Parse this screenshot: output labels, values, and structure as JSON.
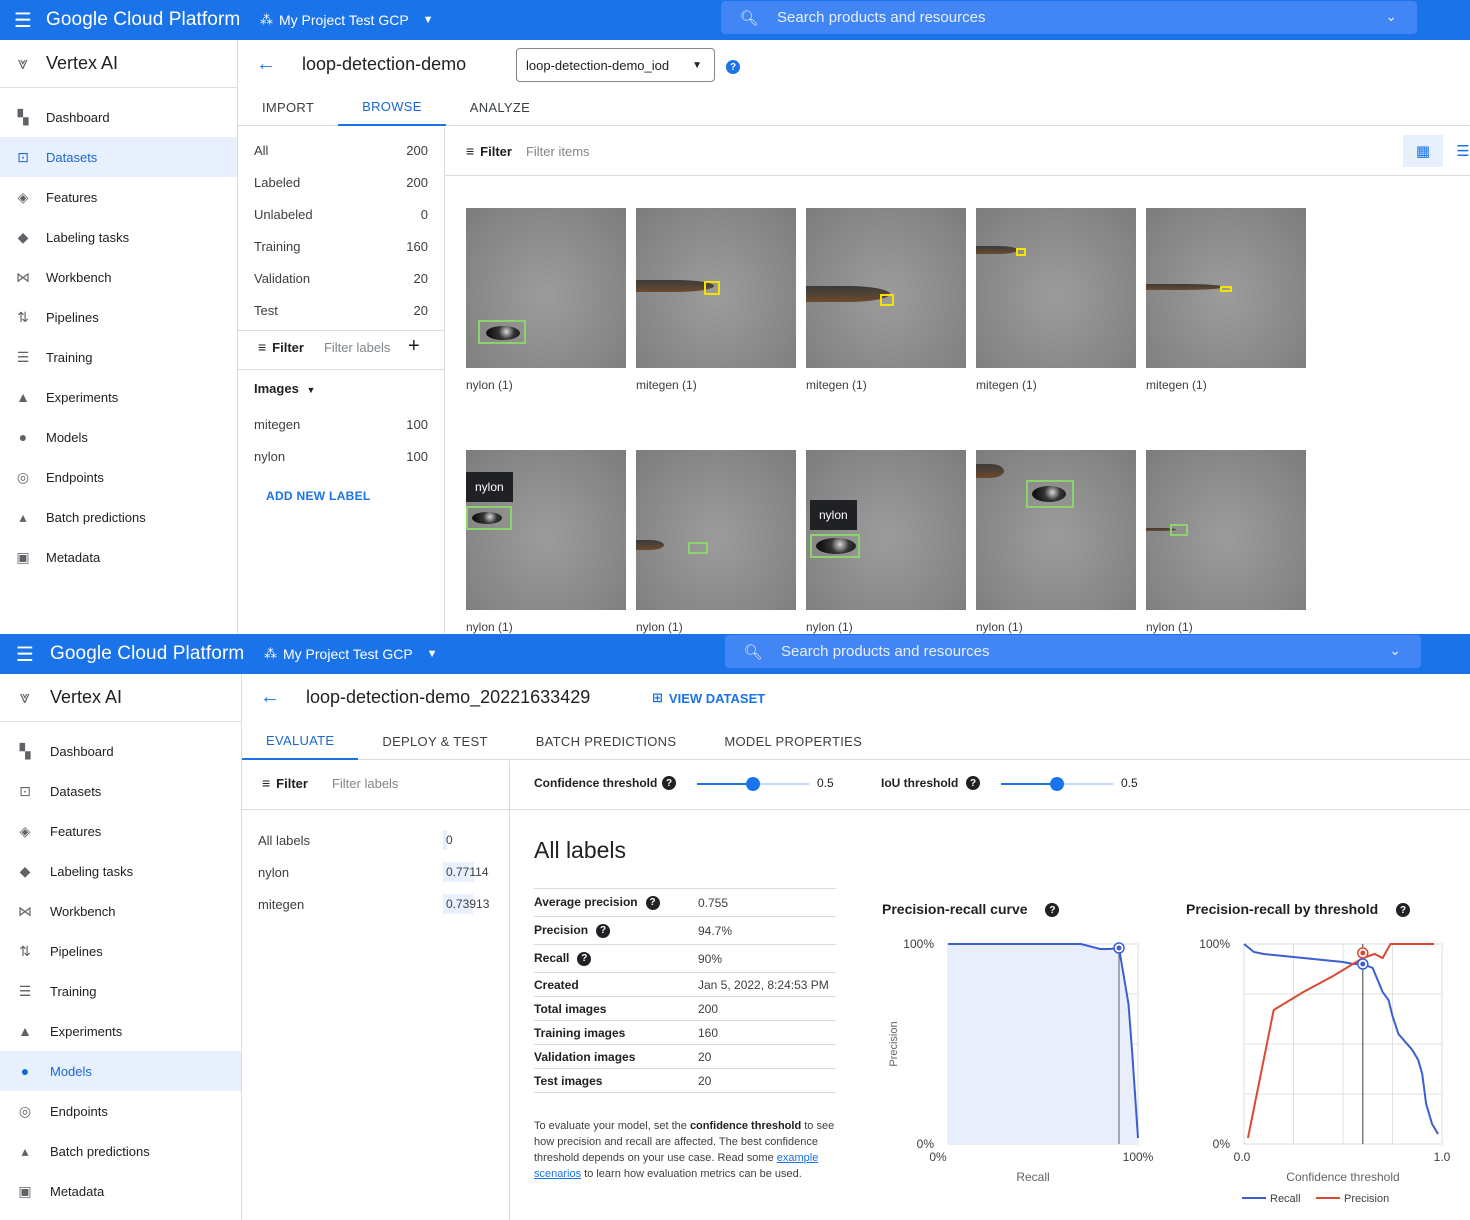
{
  "app": {
    "platform_title": "Google Cloud Platform",
    "project": "My Project Test GCP",
    "search_placeholder": "Search products and resources",
    "product": "Vertex AI"
  },
  "nav": [
    {
      "label": "Dashboard",
      "icon": "dashboard-icon"
    },
    {
      "label": "Datasets",
      "icon": "datasets-icon"
    },
    {
      "label": "Features",
      "icon": "features-icon"
    },
    {
      "label": "Labeling tasks",
      "icon": "tag-icon"
    },
    {
      "label": "Workbench",
      "icon": "workbench-icon"
    },
    {
      "label": "Pipelines",
      "icon": "pipelines-icon"
    },
    {
      "label": "Training",
      "icon": "list-icon"
    },
    {
      "label": "Experiments",
      "icon": "flask-icon"
    },
    {
      "label": "Models",
      "icon": "bulb-icon"
    },
    {
      "label": "Endpoints",
      "icon": "endpoint-icon"
    },
    {
      "label": "Batch predictions",
      "icon": "bell-icon"
    },
    {
      "label": "Metadata",
      "icon": "metadata-icon"
    }
  ],
  "browse": {
    "title": "loop-detection-demo",
    "dataset_select": "loop-detection-demo_iod",
    "tabs": [
      "IMPORT",
      "BROWSE",
      "ANALYZE"
    ],
    "active_tab": "BROWSE",
    "splits": [
      {
        "label": "All",
        "count": "200"
      },
      {
        "label": "Labeled",
        "count": "200"
      },
      {
        "label": "Unlabeled",
        "count": "0"
      },
      {
        "label": "Training",
        "count": "160"
      },
      {
        "label": "Validation",
        "count": "20"
      },
      {
        "label": "Test",
        "count": "20"
      }
    ],
    "filter_label": "Filter",
    "filter_labels_placeholder": "Filter labels",
    "filter_items_placeholder": "Filter items",
    "images_header": "Images",
    "labels": [
      {
        "label": "mitegen",
        "count": "100"
      },
      {
        "label": "nylon",
        "count": "100"
      }
    ],
    "add_label": "ADD NEW LABEL",
    "images": [
      {
        "caption": "nylon (1)",
        "tag": ""
      },
      {
        "caption": "mitegen (1)",
        "tag": ""
      },
      {
        "caption": "mitegen (1)",
        "tag": ""
      },
      {
        "caption": "mitegen (1)",
        "tag": ""
      },
      {
        "caption": "mitegen (1)",
        "tag": ""
      },
      {
        "caption": "nylon (1)",
        "tag": "nylon"
      },
      {
        "caption": "nylon (1)",
        "tag": ""
      },
      {
        "caption": "nylon (1)",
        "tag": "nylon"
      },
      {
        "caption": "nylon (1)",
        "tag": ""
      },
      {
        "caption": "nylon (1)",
        "tag": ""
      }
    ]
  },
  "evaluate": {
    "title": "loop-detection-demo_20221633429",
    "view_dataset": "VIEW DATASET",
    "tabs": [
      "EVALUATE",
      "DEPLOY & TEST",
      "BATCH PREDICTIONS",
      "MODEL PROPERTIES"
    ],
    "active_tab": "EVALUATE",
    "filter_label": "Filter",
    "filter_placeholder": "Filter labels",
    "labels": [
      {
        "label": "All labels",
        "value": "0",
        "fraction": 0
      },
      {
        "label": "nylon",
        "value": "0.77114",
        "fraction": 0.771
      },
      {
        "label": "mitegen",
        "value": "0.73913",
        "fraction": 0.739
      }
    ],
    "confidence_label": "Confidence threshold",
    "confidence_value": "0.5",
    "iou_label": "IoU threshold",
    "iou_value": "0.5",
    "heading": "All labels",
    "metrics": [
      {
        "key": "Average precision",
        "value": "0.755",
        "help": true
      },
      {
        "key": "Precision",
        "value": "94.7%",
        "help": true
      },
      {
        "key": "Recall",
        "value": "90%",
        "help": true
      },
      {
        "key": "Created",
        "value": "Jan 5, 2022, 8:24:53 PM",
        "help": false
      },
      {
        "key": "Total images",
        "value": "200",
        "help": false
      },
      {
        "key": "Training images",
        "value": "160",
        "help": false
      },
      {
        "key": "Validation images",
        "value": "20",
        "help": false
      },
      {
        "key": "Test images",
        "value": "20",
        "help": false
      }
    ],
    "note": {
      "p1": "To evaluate your model, set the ",
      "b1": "confidence threshold",
      "p2": " to see how precision and recall are affected. The best confidence threshold depends on your use case. Read some ",
      "link": "example scenarios",
      "p3": " to learn how evaluation metrics can be used."
    },
    "pr_curve": {
      "title": "Precision-recall curve",
      "xlabel": "Recall",
      "ylabel": "Precision",
      "x_ticks": [
        "0%",
        "100%"
      ],
      "y_ticks": [
        "100%",
        "0%"
      ]
    },
    "pr_threshold": {
      "title": "Precision-recall by threshold",
      "xlabel": "Confidence threshold",
      "x_ticks": [
        "0.0",
        "1.0"
      ],
      "y_ticks": [
        "100%",
        "0%"
      ],
      "legend": [
        "Recall",
        "Precision"
      ]
    }
  },
  "colors": {
    "brand": "#1a73e8",
    "recall": "#3b5fd0",
    "precision": "#d84a33"
  },
  "chart_data": [
    {
      "type": "area",
      "title": "Precision-recall curve",
      "xlabel": "Recall",
      "ylabel": "Precision",
      "xlim": [
        0,
        1
      ],
      "ylim": [
        0,
        1
      ],
      "series": [
        {
          "x": [
            0,
            0.1,
            0.2,
            0.3,
            0.4,
            0.5,
            0.6,
            0.65,
            0.7,
            0.8,
            0.85,
            0.9,
            0.95,
            0.97,
            1.0
          ],
          "y": [
            1,
            1,
            1,
            1,
            1,
            1,
            1,
            1,
            1,
            0.975,
            0.975,
            0.98,
            0.7,
            0.45,
            0.03
          ]
        }
      ],
      "highlight": {
        "x": 0.9,
        "y": 0.947
      }
    },
    {
      "type": "line",
      "title": "Precision-recall by threshold",
      "xlabel": "Confidence threshold",
      "xlim": [
        0,
        1
      ],
      "ylim": [
        0,
        1
      ],
      "series": [
        {
          "name": "Recall",
          "x": [
            0,
            0.05,
            0.1,
            0.2,
            0.3,
            0.4,
            0.5,
            0.55,
            0.6,
            0.65,
            0.7,
            0.73,
            0.75,
            0.78,
            0.85,
            0.88,
            0.9,
            0.92,
            0.95,
            0.98
          ],
          "y": [
            1,
            0.96,
            0.95,
            0.94,
            0.93,
            0.92,
            0.91,
            0.9,
            0.9,
            0.88,
            0.76,
            0.72,
            0.64,
            0.55,
            0.47,
            0.42,
            0.35,
            0.2,
            0.1,
            0.05
          ]
        },
        {
          "name": "Precision",
          "x": [
            0.02,
            0.15,
            0.3,
            0.45,
            0.6,
            0.66,
            0.7,
            0.74,
            0.8,
            0.9,
            0.96
          ],
          "y": [
            0.03,
            0.67,
            0.76,
            0.84,
            0.93,
            0.95,
            0.93,
            1,
            1,
            1,
            1
          ]
        }
      ],
      "threshold": 0.6
    }
  ]
}
